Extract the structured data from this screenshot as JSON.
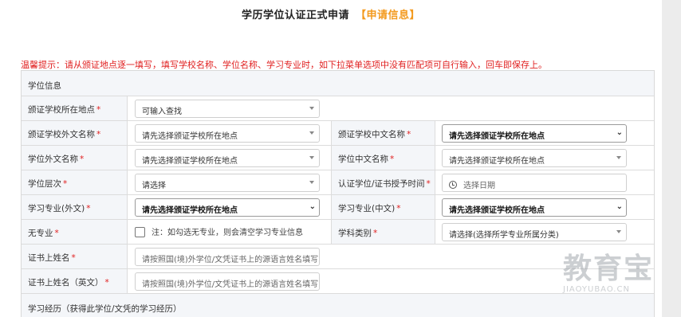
{
  "title": {
    "main": "学历学位认证正式申请",
    "accent": "【申请信息】"
  },
  "hint": "温馨提示：请从颁证地点逐一填写，填写学校名称、学位名称、学习专业时，如下拉菜单选项中没有匹配项可自行输入，回车即保存上。",
  "sections": {
    "degree_info": "学位信息",
    "study_history": "学习经历（获得此学位/文凭的学习经历）"
  },
  "form": {
    "r1": {
      "label": "颁证学校所在地点",
      "req": "*",
      "value": "可输入查找"
    },
    "r2": {
      "label": "颁证学校外文名称",
      "req": "*",
      "value": "请先选择颁证学校所在地点",
      "label2": "颁证学校中文名称",
      "req2": "*",
      "value2": "请先选择颁证学校所在地点"
    },
    "r3": {
      "label": "学位外文名称",
      "req": "*",
      "value": "请先选择颁证学校所在地点",
      "label2": "学位中文名称",
      "req2": "*",
      "value2": "请先选择颁证学校所在地点"
    },
    "r4": {
      "label": "学位层次",
      "req": "*",
      "value": "请选择",
      "label2": "认证学位/证书授予时间",
      "req2": "*",
      "value2": "选择日期"
    },
    "r5": {
      "label": "学习专业(外文)",
      "req": "*",
      "value": "请先选择颁证学校所在地点",
      "label2": "学习专业(中文)",
      "req2": "*",
      "value2": "请先选择颁证学校所在地点"
    },
    "r6": {
      "label": "无专业",
      "req": "*",
      "checkbox_text": "注：如勾选无专业，则会清空学习专业信息",
      "label2": "学科类别",
      "req2": "*",
      "value2": "请选择(选择所学专业所属分类)"
    },
    "r7": {
      "label": "证书上姓名",
      "req": "*",
      "placeholder": "请按照国(境)外学位/文凭证书上的源语言姓名填写"
    },
    "r8": {
      "label": "证书上姓名（英文）",
      "req": "*",
      "placeholder": "请按照国(境)外学位/文凭证书上的源语言姓名填写"
    }
  },
  "watermark": {
    "cn": "教育宝",
    "en": "JIAOYUBAO.CN"
  }
}
